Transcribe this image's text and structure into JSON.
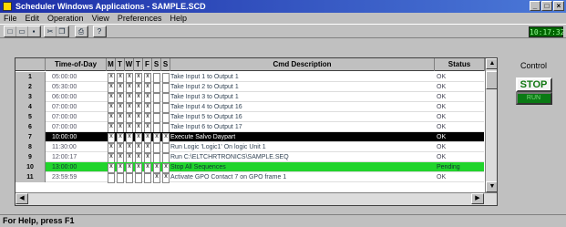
{
  "window": {
    "title": "Scheduler Windows Applications - SAMPLE.SCD"
  },
  "menu": [
    "File",
    "Edit",
    "Operation",
    "View",
    "Preferences",
    "Help"
  ],
  "toolbar": {
    "group1_icons": [
      "new-icon",
      "open-icon",
      "save-icon"
    ],
    "group2_icons": [
      "cut-icon",
      "copy-icon"
    ],
    "group3_icons": [
      "print-icon"
    ],
    "group4_icons": [
      "help-icon"
    ],
    "clock": "10:17:32"
  },
  "table": {
    "headers": {
      "time": "Time-of-Day",
      "days": [
        "M",
        "T",
        "W",
        "T",
        "F",
        "S",
        "S"
      ],
      "desc": "Cmd Description",
      "status": "Status"
    },
    "rows": [
      {
        "n": "1",
        "time": "05:00:00",
        "days": [
          "x",
          "x",
          "x",
          "x",
          "x",
          "",
          ""
        ],
        "desc": "Take Input 1 to Output 1",
        "status": "OK",
        "style": ""
      },
      {
        "n": "2",
        "time": "05:30:00",
        "days": [
          "x",
          "x",
          "x",
          "x",
          "x",
          "",
          ""
        ],
        "desc": "Take Input 2 to Output 1",
        "status": "OK",
        "style": ""
      },
      {
        "n": "3",
        "time": "06:00:00",
        "days": [
          "x",
          "x",
          "x",
          "x",
          "x",
          "",
          ""
        ],
        "desc": "Take Input 3 to Output 1",
        "status": "OK",
        "style": ""
      },
      {
        "n": "4",
        "time": "07:00:00",
        "days": [
          "x",
          "x",
          "x",
          "x",
          "x",
          "",
          ""
        ],
        "desc": "Take Input 4 to Output 16",
        "status": "OK",
        "style": ""
      },
      {
        "n": "5",
        "time": "07:00:00",
        "days": [
          "x",
          "x",
          "x",
          "x",
          "x",
          "",
          ""
        ],
        "desc": "Take Input 5 to Output 16",
        "status": "OK",
        "style": ""
      },
      {
        "n": "6",
        "time": "07:00:00",
        "days": [
          "x",
          "x",
          "x",
          "x",
          "x",
          "",
          ""
        ],
        "desc": "Take Input 6 to Output 17",
        "status": "OK",
        "style": ""
      },
      {
        "n": "7",
        "time": "10:00:00",
        "days": [
          "x",
          "x",
          "x",
          "x",
          "x",
          "x",
          "x"
        ],
        "desc": "Execute Salvo Daypart",
        "status": "OK",
        "style": "black"
      },
      {
        "n": "8",
        "time": "11:30:00",
        "days": [
          "x",
          "x",
          "x",
          "x",
          "x",
          "",
          ""
        ],
        "desc": "Run Logic 'Logic1' On logic Unit 1",
        "status": "OK",
        "style": ""
      },
      {
        "n": "9",
        "time": "12:00:17",
        "days": [
          "x",
          "x",
          "x",
          "x",
          "x",
          "",
          ""
        ],
        "desc": "Run C:\\ELTCHRTRONICS\\SAMPLE.SEQ",
        "status": "OK",
        "style": ""
      },
      {
        "n": "10",
        "time": "13:00:00",
        "days": [
          "x",
          "x",
          "x",
          "x",
          "x",
          "x",
          "x"
        ],
        "desc": "Stop All Sequences",
        "status": "Pending",
        "style": "green"
      },
      {
        "n": "11",
        "time": "23:59:59",
        "days": [
          "",
          "",
          "",
          "",
          "",
          "x",
          "x"
        ],
        "desc": "Activate GPO Contact 7 on GPO frame 1",
        "status": "OK",
        "style": ""
      }
    ]
  },
  "control": {
    "label": "Control",
    "stop": "STOP",
    "run": "RUN"
  },
  "statusbar": "For Help, press F1"
}
